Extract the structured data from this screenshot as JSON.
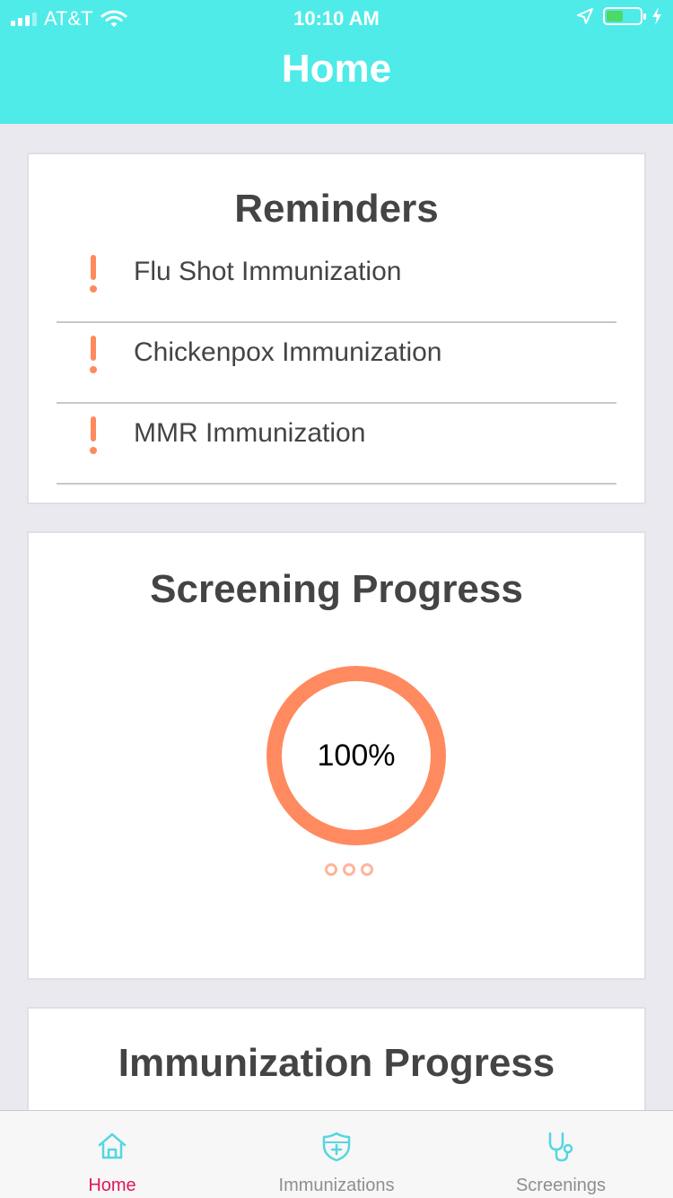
{
  "status_bar": {
    "carrier": "AT&T",
    "time": "10:10 AM",
    "battery_level": 0.5
  },
  "nav": {
    "title": "Home"
  },
  "reminders": {
    "title": "Reminders",
    "items": [
      {
        "label": "Flu Shot Immunization"
      },
      {
        "label": "Chickenpox Immunization"
      },
      {
        "label": "MMR Immunization"
      }
    ]
  },
  "screening": {
    "title": "Screening Progress",
    "progress_label": "100%",
    "progress_value": 100
  },
  "immunization": {
    "title": "Immunization Progress"
  },
  "tabs": [
    {
      "label": "Home",
      "icon": "home-icon",
      "active": true
    },
    {
      "label": "Immunizations",
      "icon": "shield-icon",
      "active": false
    },
    {
      "label": "Screenings",
      "icon": "stethoscope-icon",
      "active": false
    }
  ],
  "colors": {
    "header": "#4eebe9",
    "accent": "#ff8a5f",
    "tab_active": "#e0185b",
    "tab_icon": "#55d6e0"
  }
}
